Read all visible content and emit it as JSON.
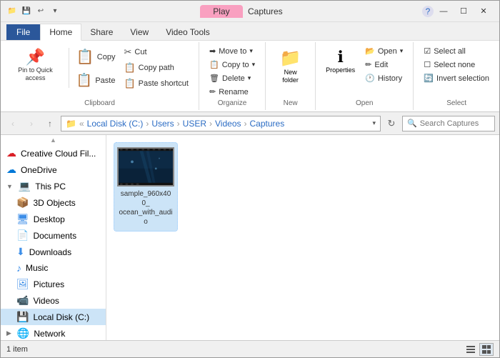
{
  "titleBar": {
    "title": "Captures",
    "playLabel": "Play",
    "icons": [
      "📁",
      "💾",
      "↩"
    ],
    "windowControls": [
      "—",
      "☐",
      "✕"
    ]
  },
  "ribbonTabs": [
    {
      "label": "File",
      "id": "file",
      "active": false
    },
    {
      "label": "Home",
      "id": "home",
      "active": true
    },
    {
      "label": "Share",
      "id": "share",
      "active": false
    },
    {
      "label": "View",
      "id": "view",
      "active": false
    },
    {
      "label": "Video Tools",
      "id": "videotools",
      "active": false
    }
  ],
  "ribbon": {
    "clipboard": {
      "label": "Clipboard",
      "pinLabel": "Pin to Quick\naccess",
      "copyLabel": "Copy",
      "pasteLabel": "Paste",
      "cutLabel": "Cut",
      "copyPathLabel": "Copy path",
      "pasteShortcutLabel": "Paste shortcut"
    },
    "organize": {
      "label": "Organize",
      "moveToLabel": "Move to",
      "copyToLabel": "Copy to",
      "deleteLabel": "Delete",
      "renameLabel": "Rename"
    },
    "new": {
      "label": "New",
      "newFolderLabel": "New\nfolder"
    },
    "open": {
      "label": "Open",
      "openLabel": "Open",
      "editLabel": "Edit",
      "historyLabel": "History",
      "propertiesLabel": "Properties"
    },
    "select": {
      "label": "Select",
      "selectAllLabel": "Select all",
      "selectNoneLabel": "Select none",
      "invertSelectionLabel": "Invert selection"
    }
  },
  "addressBar": {
    "path": [
      "Local Disk (C:)",
      "Users",
      "USER",
      "Videos",
      "Captures"
    ],
    "searchPlaceholder": "Search Captures"
  },
  "sidebar": {
    "items": [
      {
        "label": "Creative Cloud Fil...",
        "icon": "☁️",
        "indent": 0
      },
      {
        "label": "OneDrive",
        "icon": "☁",
        "indent": 0
      },
      {
        "label": "This PC",
        "icon": "💻",
        "indent": 0,
        "isSection": true
      },
      {
        "label": "3D Objects",
        "icon": "📦",
        "indent": 1
      },
      {
        "label": "Desktop",
        "icon": "🖥",
        "indent": 1
      },
      {
        "label": "Documents",
        "icon": "📄",
        "indent": 1
      },
      {
        "label": "Downloads",
        "icon": "⬇",
        "indent": 1
      },
      {
        "label": "Music",
        "icon": "♪",
        "indent": 1
      },
      {
        "label": "Pictures",
        "icon": "🖼",
        "indent": 1
      },
      {
        "label": "Videos",
        "icon": "📹",
        "indent": 1
      },
      {
        "label": "Local Disk (C:)",
        "icon": "💾",
        "indent": 1,
        "active": true
      },
      {
        "label": "Network",
        "icon": "🌐",
        "indent": 0
      }
    ]
  },
  "content": {
    "files": [
      {
        "name": "sample_960x400_ocean_with_audi o",
        "selected": true
      }
    ]
  },
  "statusBar": {
    "text": "1 item",
    "views": [
      "list",
      "details"
    ]
  }
}
